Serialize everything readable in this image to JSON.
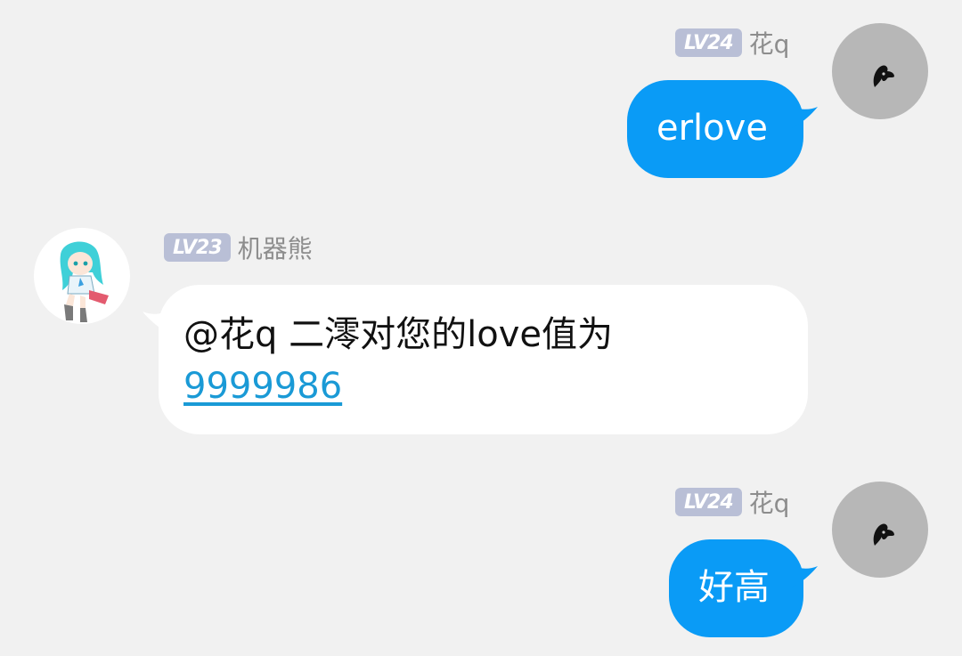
{
  "messages": [
    {
      "sender": "花q",
      "level": "LV24",
      "text": "erlove",
      "side": "right",
      "bubble_color": "#0a9bf6"
    },
    {
      "sender": "机器熊",
      "level": "LV23",
      "line1": "@花q 二澪对您的love值为",
      "link": "9999986",
      "side": "left",
      "bubble_color": "#ffffff"
    },
    {
      "sender": "花q",
      "level": "LV24",
      "text": "好高",
      "side": "right",
      "bubble_color": "#0a9bf6"
    }
  ],
  "icons": {
    "self_avatar": "moth-silhouette-icon",
    "bot_avatar": "anime-girl-avatar"
  }
}
